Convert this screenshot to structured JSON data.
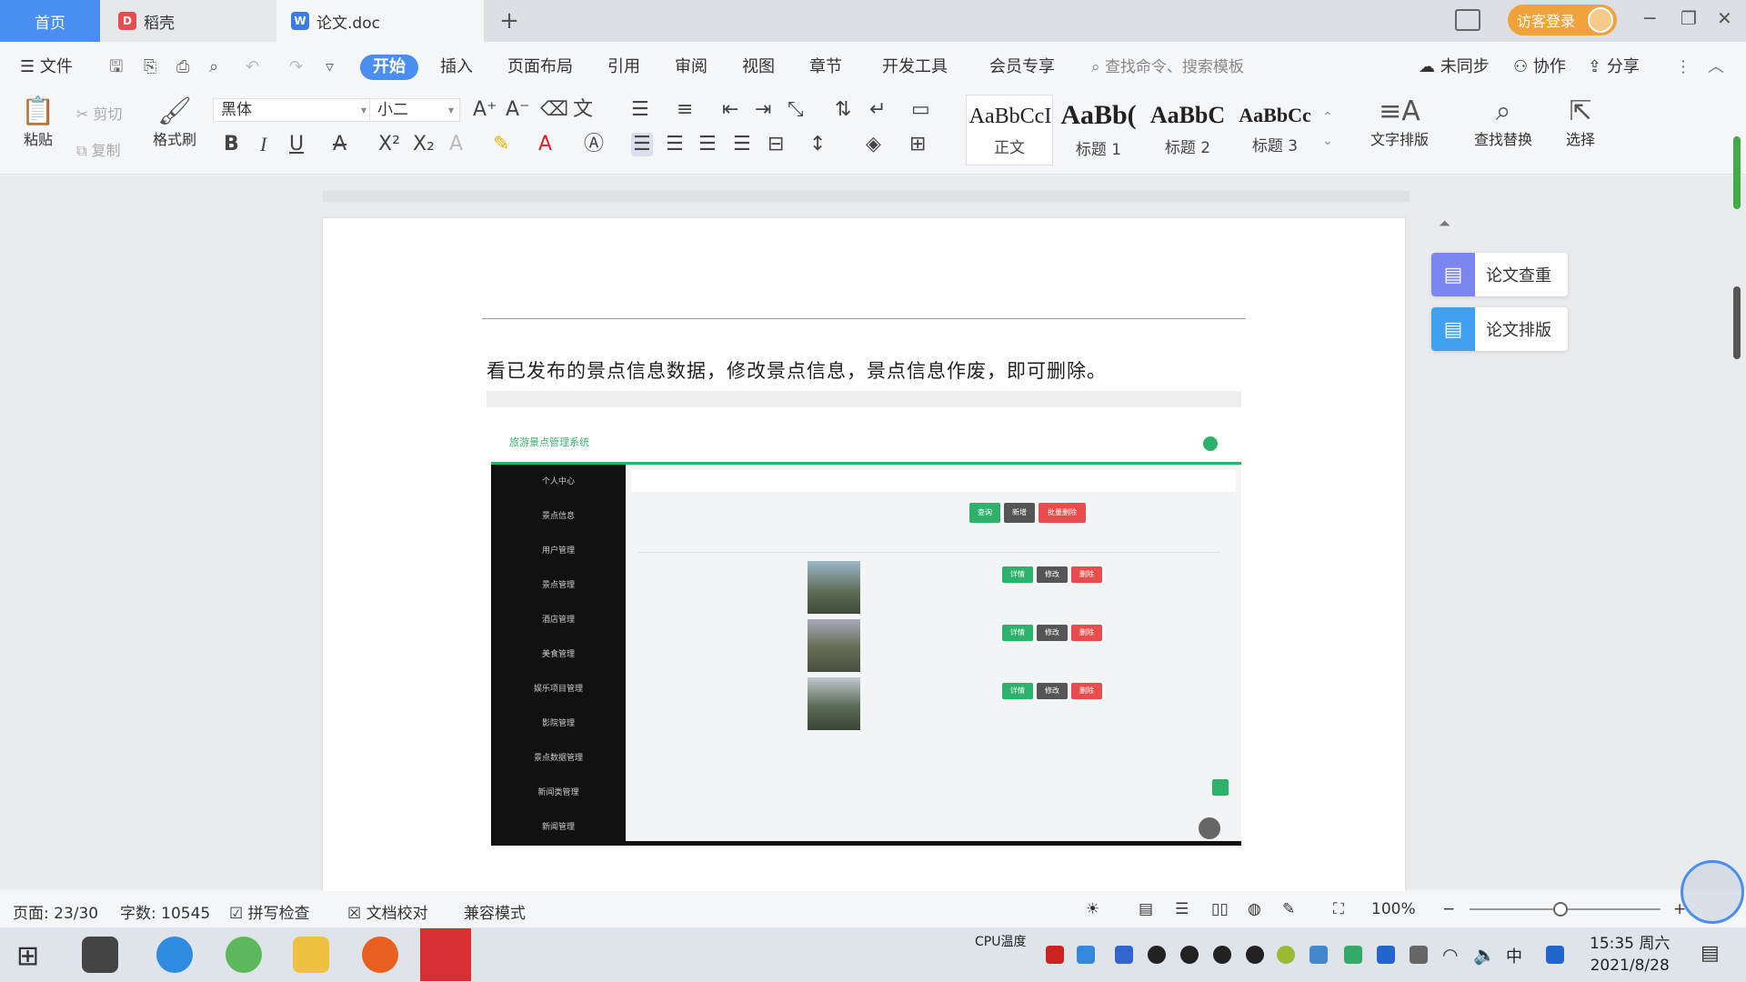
{
  "tabs": {
    "home": "首页",
    "daoke": "稻壳",
    "doc": "论文.doc",
    "add": "+"
  },
  "titlebar": {
    "login": "访客登录"
  },
  "menu": {
    "file": "文件",
    "items": [
      "开始",
      "插入",
      "页面布局",
      "引用",
      "审阅",
      "视图",
      "章节",
      "开发工具",
      "会员专享"
    ],
    "search": "查找命令、搜索模板",
    "sync": "未同步",
    "collab": "协作",
    "share": "分享"
  },
  "ribbon": {
    "paste": "粘贴",
    "cut": "剪切",
    "copy": "复制",
    "format_painter": "格式刷",
    "font_name": "黑体",
    "font_size": "小二",
    "styles": [
      {
        "preview": "AaBbCcI",
        "label": "正文"
      },
      {
        "preview": "AaBb(",
        "label": "标题 1"
      },
      {
        "preview": "AaBbC",
        "label": "标题 2"
      },
      {
        "preview": "AaBbCc",
        "label": "标题 3"
      }
    ],
    "text_layout": "文字排版",
    "find_replace": "查找替换",
    "select": "选择"
  },
  "document": {
    "body_text": "看已发布的景点信息数据，修改景点信息，景点信息作废，即可删除。",
    "embedded": {
      "site_title": "旅游景点管理系统",
      "sidebar": [
        "个人中心",
        "景点信息",
        "用户管理",
        "景点管理",
        "酒店管理",
        "美食管理",
        "娱乐项目管理",
        "影院管理",
        "景点数据管理",
        "新闻类管理",
        "新闻管理"
      ],
      "buttons": {
        "search": "查询",
        "add": "新增",
        "delete": "批量删除",
        "detail": "详情",
        "edit": "修改",
        "remove": "删除"
      }
    }
  },
  "side_panel": {
    "check": "论文查重",
    "layout": "论文排版"
  },
  "status": {
    "page": "页面: 23/30",
    "words": "字数: 10545",
    "spell": "拼写检查",
    "proof": "文档校对",
    "compat": "兼容模式",
    "zoom": "100%"
  },
  "taskbar": {
    "cpu": "CPU温度",
    "ime": "中",
    "time": "15:35 周六",
    "date": "2021/8/28"
  },
  "colors": {
    "accent": "#4a8ef0",
    "green": "#2eb26b",
    "red": "#e84c4c"
  }
}
